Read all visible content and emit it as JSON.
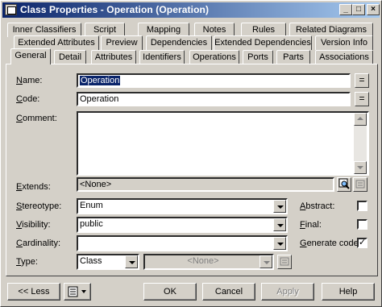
{
  "window": {
    "title": "Class Properties - Operation (Operation)",
    "controls": {
      "minimize": "_",
      "maximize": "□",
      "close": "×"
    }
  },
  "tabs": {
    "row1": [
      "Inner Classifiers",
      "Script",
      "Mapping",
      "Notes",
      "Rules",
      "Related Diagrams"
    ],
    "row2": [
      "Extended Attributes",
      "Preview",
      "Dependencies",
      "Extended Dependencies",
      "Version Info"
    ],
    "row3": [
      "General",
      "Detail",
      "Attributes",
      "Identifiers",
      "Operations",
      "Ports",
      "Parts",
      "Associations"
    ],
    "active": "General"
  },
  "form": {
    "name_label_u": "N",
    "name_label_rest": "ame:",
    "name_value": "Operation",
    "code_label_u": "C",
    "code_label_rest": "ode:",
    "code_value": "Operation",
    "equals_btn": "=",
    "comment_label_u": "C",
    "comment_label_rest": "omment:",
    "comment_value": "",
    "extends_label_u": "E",
    "extends_label_rest": "xtends:",
    "extends_value": "<None>",
    "stereotype_label_u": "S",
    "stereotype_label_rest": "tereotype:",
    "stereotype_value": "Enum",
    "visibility_label_u": "V",
    "visibility_label_rest": "isibility:",
    "visibility_value": "public",
    "cardinality_label_u": "C",
    "cardinality_label_rest": "ardinality:",
    "cardinality_value": "",
    "type_label_u": "T",
    "type_label_rest": "ype:",
    "type_value": "Class",
    "type_sub_value": "<None>",
    "abstract_label_u": "A",
    "abstract_label_rest": "bstract:",
    "abstract_checked": "",
    "final_label_u": "F",
    "final_label_rest": "inal:",
    "final_checked": "",
    "generate_label_u": "G",
    "generate_label_rest": "enerate code:",
    "generate_checked": "✓"
  },
  "buttons": {
    "less": "<< Less",
    "ok": "OK",
    "cancel": "Cancel",
    "apply": "Apply",
    "help": "Help"
  }
}
